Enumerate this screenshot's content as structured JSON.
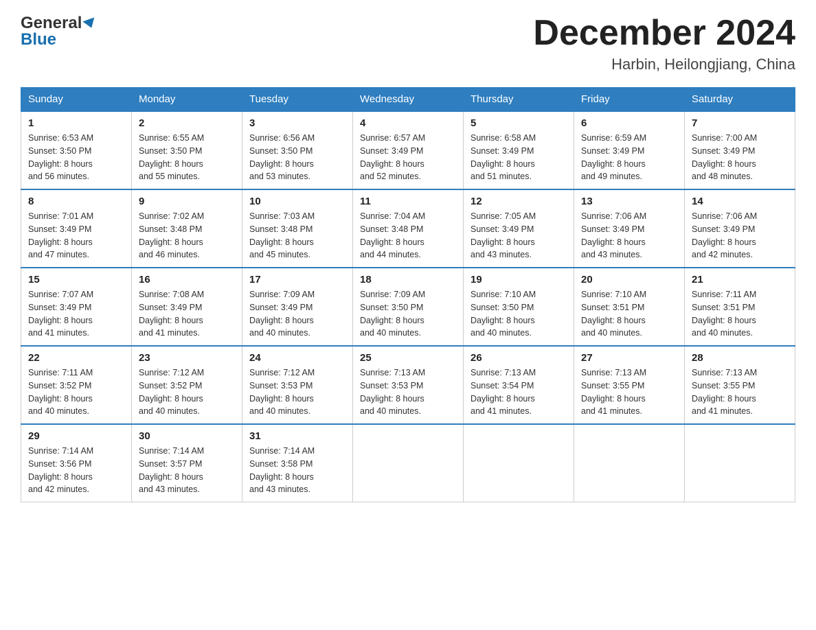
{
  "header": {
    "logo_line1": "General",
    "logo_line2": "Blue",
    "month_title": "December 2024",
    "location": "Harbin, Heilongjiang, China"
  },
  "days_of_week": [
    "Sunday",
    "Monday",
    "Tuesday",
    "Wednesday",
    "Thursday",
    "Friday",
    "Saturday"
  ],
  "weeks": [
    [
      {
        "day": "1",
        "sunrise": "6:53 AM",
        "sunset": "3:50 PM",
        "daylight": "8 hours and 56 minutes."
      },
      {
        "day": "2",
        "sunrise": "6:55 AM",
        "sunset": "3:50 PM",
        "daylight": "8 hours and 55 minutes."
      },
      {
        "day": "3",
        "sunrise": "6:56 AM",
        "sunset": "3:50 PM",
        "daylight": "8 hours and 53 minutes."
      },
      {
        "day": "4",
        "sunrise": "6:57 AM",
        "sunset": "3:49 PM",
        "daylight": "8 hours and 52 minutes."
      },
      {
        "day": "5",
        "sunrise": "6:58 AM",
        "sunset": "3:49 PM",
        "daylight": "8 hours and 51 minutes."
      },
      {
        "day": "6",
        "sunrise": "6:59 AM",
        "sunset": "3:49 PM",
        "daylight": "8 hours and 49 minutes."
      },
      {
        "day": "7",
        "sunrise": "7:00 AM",
        "sunset": "3:49 PM",
        "daylight": "8 hours and 48 minutes."
      }
    ],
    [
      {
        "day": "8",
        "sunrise": "7:01 AM",
        "sunset": "3:49 PM",
        "daylight": "8 hours and 47 minutes."
      },
      {
        "day": "9",
        "sunrise": "7:02 AM",
        "sunset": "3:48 PM",
        "daylight": "8 hours and 46 minutes."
      },
      {
        "day": "10",
        "sunrise": "7:03 AM",
        "sunset": "3:48 PM",
        "daylight": "8 hours and 45 minutes."
      },
      {
        "day": "11",
        "sunrise": "7:04 AM",
        "sunset": "3:48 PM",
        "daylight": "8 hours and 44 minutes."
      },
      {
        "day": "12",
        "sunrise": "7:05 AM",
        "sunset": "3:49 PM",
        "daylight": "8 hours and 43 minutes."
      },
      {
        "day": "13",
        "sunrise": "7:06 AM",
        "sunset": "3:49 PM",
        "daylight": "8 hours and 43 minutes."
      },
      {
        "day": "14",
        "sunrise": "7:06 AM",
        "sunset": "3:49 PM",
        "daylight": "8 hours and 42 minutes."
      }
    ],
    [
      {
        "day": "15",
        "sunrise": "7:07 AM",
        "sunset": "3:49 PM",
        "daylight": "8 hours and 41 minutes."
      },
      {
        "day": "16",
        "sunrise": "7:08 AM",
        "sunset": "3:49 PM",
        "daylight": "8 hours and 41 minutes."
      },
      {
        "day": "17",
        "sunrise": "7:09 AM",
        "sunset": "3:49 PM",
        "daylight": "8 hours and 40 minutes."
      },
      {
        "day": "18",
        "sunrise": "7:09 AM",
        "sunset": "3:50 PM",
        "daylight": "8 hours and 40 minutes."
      },
      {
        "day": "19",
        "sunrise": "7:10 AM",
        "sunset": "3:50 PM",
        "daylight": "8 hours and 40 minutes."
      },
      {
        "day": "20",
        "sunrise": "7:10 AM",
        "sunset": "3:51 PM",
        "daylight": "8 hours and 40 minutes."
      },
      {
        "day": "21",
        "sunrise": "7:11 AM",
        "sunset": "3:51 PM",
        "daylight": "8 hours and 40 minutes."
      }
    ],
    [
      {
        "day": "22",
        "sunrise": "7:11 AM",
        "sunset": "3:52 PM",
        "daylight": "8 hours and 40 minutes."
      },
      {
        "day": "23",
        "sunrise": "7:12 AM",
        "sunset": "3:52 PM",
        "daylight": "8 hours and 40 minutes."
      },
      {
        "day": "24",
        "sunrise": "7:12 AM",
        "sunset": "3:53 PM",
        "daylight": "8 hours and 40 minutes."
      },
      {
        "day": "25",
        "sunrise": "7:13 AM",
        "sunset": "3:53 PM",
        "daylight": "8 hours and 40 minutes."
      },
      {
        "day": "26",
        "sunrise": "7:13 AM",
        "sunset": "3:54 PM",
        "daylight": "8 hours and 41 minutes."
      },
      {
        "day": "27",
        "sunrise": "7:13 AM",
        "sunset": "3:55 PM",
        "daylight": "8 hours and 41 minutes."
      },
      {
        "day": "28",
        "sunrise": "7:13 AM",
        "sunset": "3:55 PM",
        "daylight": "8 hours and 41 minutes."
      }
    ],
    [
      {
        "day": "29",
        "sunrise": "7:14 AM",
        "sunset": "3:56 PM",
        "daylight": "8 hours and 42 minutes."
      },
      {
        "day": "30",
        "sunrise": "7:14 AM",
        "sunset": "3:57 PM",
        "daylight": "8 hours and 43 minutes."
      },
      {
        "day": "31",
        "sunrise": "7:14 AM",
        "sunset": "3:58 PM",
        "daylight": "8 hours and 43 minutes."
      },
      null,
      null,
      null,
      null
    ]
  ],
  "labels": {
    "sunrise": "Sunrise: ",
    "sunset": "Sunset: ",
    "daylight": "Daylight: "
  }
}
